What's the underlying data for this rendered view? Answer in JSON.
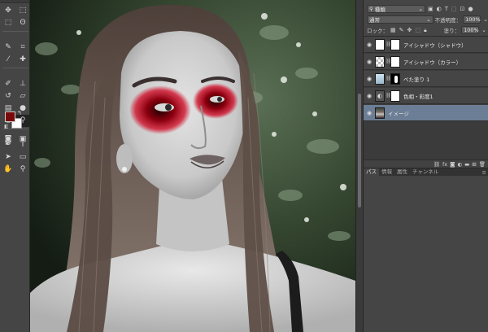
{
  "tools": [
    {
      "icon": "move-icon",
      "glyph": "✥"
    },
    {
      "icon": "artboard-icon",
      "glyph": "⬚"
    },
    {
      "icon": "marquee-icon",
      "glyph": "⬚"
    },
    {
      "icon": "lasso-icon",
      "glyph": "ʘ"
    },
    {
      "icon": "quick-select-icon",
      "glyph": "✎"
    },
    {
      "icon": "crop-icon",
      "glyph": "⌗"
    },
    {
      "icon": "eyedropper-icon",
      "glyph": "⁄"
    },
    {
      "icon": "healing-brush-icon",
      "glyph": "✚"
    },
    {
      "icon": "brush-icon",
      "glyph": "✐"
    },
    {
      "icon": "clone-stamp-icon",
      "glyph": "⊥"
    },
    {
      "icon": "history-brush-icon",
      "glyph": "↺"
    },
    {
      "icon": "eraser-icon",
      "glyph": "▱"
    },
    {
      "icon": "gradient-icon",
      "glyph": "▤"
    },
    {
      "icon": "blur-icon",
      "glyph": "●"
    },
    {
      "icon": "dodge-icon",
      "glyph": "○"
    },
    {
      "icon": "zoom-icon-active",
      "glyph": "⚲"
    },
    {
      "icon": "pen-icon",
      "glyph": "✒"
    },
    {
      "icon": "type-icon",
      "glyph": "T"
    },
    {
      "icon": "path-select-icon",
      "glyph": "➤"
    },
    {
      "icon": "shape-icon",
      "glyph": "▭"
    },
    {
      "icon": "hand-icon",
      "glyph": "✋"
    },
    {
      "icon": "zoom-icon",
      "glyph": "⚲"
    }
  ],
  "tools_bottom": [
    {
      "icon": "quick-mask-icon",
      "glyph": "◙"
    },
    {
      "icon": "screen-mode-icon",
      "glyph": "▣"
    }
  ],
  "colors": {
    "foreground": "#7a0a0a",
    "background": "#ffffff",
    "selected_layer": "#6c7e95"
  },
  "panel": {
    "filter_kind": "種類",
    "blend_mode": "通常",
    "opacity_label": "不透明度：",
    "opacity_value": "100%",
    "lock_label": "ロック：",
    "fill_label": "塗り：",
    "fill_value": "100%"
  },
  "layers": [
    {
      "name": "アイシャドウ（シャドウ）",
      "thumb": "white",
      "mask": "white",
      "selected": false
    },
    {
      "name": "アイシャドウ（カラー）",
      "thumb": "check",
      "mask": "white",
      "selected": false
    },
    {
      "name": "べた塗り 1",
      "thumb": "sky",
      "mask": "mask",
      "selected": false
    },
    {
      "name": "色相・彩度1",
      "thumb": "adj",
      "mask": "white",
      "selected": false
    },
    {
      "name": "イメージ",
      "thumb": "photo",
      "mask": "",
      "selected": true
    }
  ],
  "layer_footer_icons": [
    "link-icon",
    "fx-icon",
    "mask-icon",
    "adjustment-icon",
    "folder-icon",
    "new-layer-icon",
    "trash-icon"
  ],
  "tabs": [
    "パス",
    "情報",
    "属性",
    "チャンネル"
  ]
}
